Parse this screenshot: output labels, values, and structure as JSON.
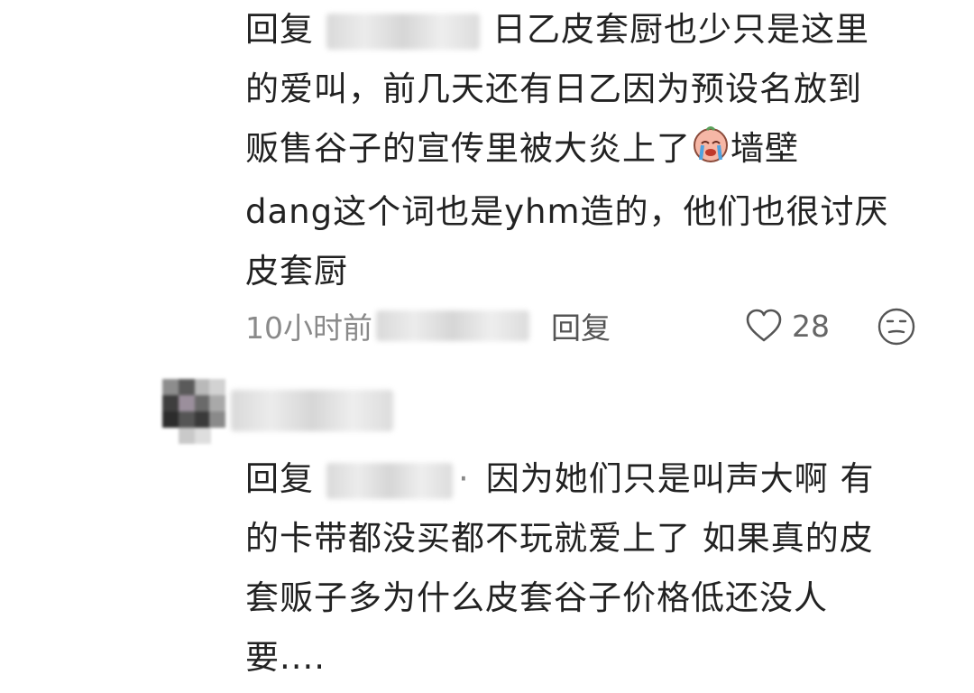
{
  "comment1": {
    "reply_prefix": "回复",
    "text_line1": "日乙皮套厨也少只是这里",
    "text_line2": "的爱叫，前几天还有日乙因为预设名放到",
    "text_line3a": "贩售谷子的宣传里被大炎上了",
    "text_line3b": "墙壁",
    "text_line4": "dang这个词也是yhm造的，他们也很讨厌",
    "text_line5": "皮套厨",
    "time": "10小时前",
    "reply_label": "回复",
    "like_count": "28"
  },
  "comment2": {
    "reply_prefix": "回复",
    "separator": "·",
    "text_line1": "因为她们只是叫声大啊 有",
    "text_line2": "的卡带都没买都不玩就爱上了 如果真的皮",
    "text_line3": "套贩子多为什么皮套谷子价格低还没人",
    "text_line4": "要...."
  },
  "icons": {
    "like": "heart-outline-icon",
    "react": "neutral-face-icon",
    "inline_emoji": "crying-face-emoji"
  }
}
